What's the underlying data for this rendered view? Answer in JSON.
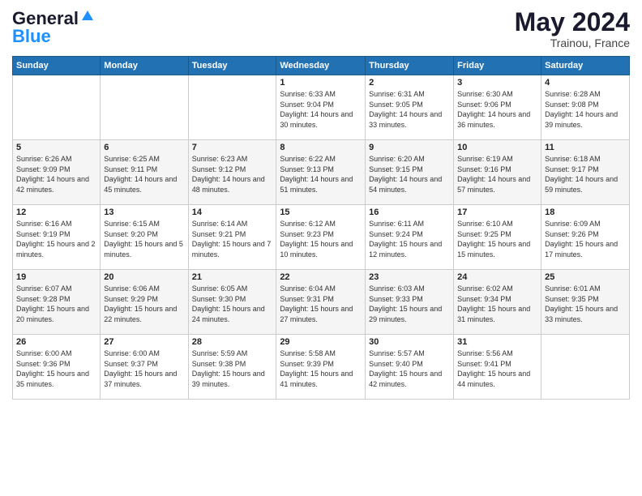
{
  "header": {
    "logo_general": "General",
    "logo_blue": "Blue",
    "month_year": "May 2024",
    "location": "Trainou, France"
  },
  "weekdays": [
    "Sunday",
    "Monday",
    "Tuesday",
    "Wednesday",
    "Thursday",
    "Friday",
    "Saturday"
  ],
  "weeks": [
    [
      {
        "day": "",
        "sunrise": "",
        "sunset": "",
        "daylight": ""
      },
      {
        "day": "",
        "sunrise": "",
        "sunset": "",
        "daylight": ""
      },
      {
        "day": "",
        "sunrise": "",
        "sunset": "",
        "daylight": ""
      },
      {
        "day": "1",
        "sunrise": "6:33 AM",
        "sunset": "9:04 PM",
        "daylight": "14 hours and 30 minutes."
      },
      {
        "day": "2",
        "sunrise": "6:31 AM",
        "sunset": "9:05 PM",
        "daylight": "14 hours and 33 minutes."
      },
      {
        "day": "3",
        "sunrise": "6:30 AM",
        "sunset": "9:06 PM",
        "daylight": "14 hours and 36 minutes."
      },
      {
        "day": "4",
        "sunrise": "6:28 AM",
        "sunset": "9:08 PM",
        "daylight": "14 hours and 39 minutes."
      }
    ],
    [
      {
        "day": "5",
        "sunrise": "6:26 AM",
        "sunset": "9:09 PM",
        "daylight": "14 hours and 42 minutes."
      },
      {
        "day": "6",
        "sunrise": "6:25 AM",
        "sunset": "9:11 PM",
        "daylight": "14 hours and 45 minutes."
      },
      {
        "day": "7",
        "sunrise": "6:23 AM",
        "sunset": "9:12 PM",
        "daylight": "14 hours and 48 minutes."
      },
      {
        "day": "8",
        "sunrise": "6:22 AM",
        "sunset": "9:13 PM",
        "daylight": "14 hours and 51 minutes."
      },
      {
        "day": "9",
        "sunrise": "6:20 AM",
        "sunset": "9:15 PM",
        "daylight": "14 hours and 54 minutes."
      },
      {
        "day": "10",
        "sunrise": "6:19 AM",
        "sunset": "9:16 PM",
        "daylight": "14 hours and 57 minutes."
      },
      {
        "day": "11",
        "sunrise": "6:18 AM",
        "sunset": "9:17 PM",
        "daylight": "14 hours and 59 minutes."
      }
    ],
    [
      {
        "day": "12",
        "sunrise": "6:16 AM",
        "sunset": "9:19 PM",
        "daylight": "15 hours and 2 minutes."
      },
      {
        "day": "13",
        "sunrise": "6:15 AM",
        "sunset": "9:20 PM",
        "daylight": "15 hours and 5 minutes."
      },
      {
        "day": "14",
        "sunrise": "6:14 AM",
        "sunset": "9:21 PM",
        "daylight": "15 hours and 7 minutes."
      },
      {
        "day": "15",
        "sunrise": "6:12 AM",
        "sunset": "9:23 PM",
        "daylight": "15 hours and 10 minutes."
      },
      {
        "day": "16",
        "sunrise": "6:11 AM",
        "sunset": "9:24 PM",
        "daylight": "15 hours and 12 minutes."
      },
      {
        "day": "17",
        "sunrise": "6:10 AM",
        "sunset": "9:25 PM",
        "daylight": "15 hours and 15 minutes."
      },
      {
        "day": "18",
        "sunrise": "6:09 AM",
        "sunset": "9:26 PM",
        "daylight": "15 hours and 17 minutes."
      }
    ],
    [
      {
        "day": "19",
        "sunrise": "6:07 AM",
        "sunset": "9:28 PM",
        "daylight": "15 hours and 20 minutes."
      },
      {
        "day": "20",
        "sunrise": "6:06 AM",
        "sunset": "9:29 PM",
        "daylight": "15 hours and 22 minutes."
      },
      {
        "day": "21",
        "sunrise": "6:05 AM",
        "sunset": "9:30 PM",
        "daylight": "15 hours and 24 minutes."
      },
      {
        "day": "22",
        "sunrise": "6:04 AM",
        "sunset": "9:31 PM",
        "daylight": "15 hours and 27 minutes."
      },
      {
        "day": "23",
        "sunrise": "6:03 AM",
        "sunset": "9:33 PM",
        "daylight": "15 hours and 29 minutes."
      },
      {
        "day": "24",
        "sunrise": "6:02 AM",
        "sunset": "9:34 PM",
        "daylight": "15 hours and 31 minutes."
      },
      {
        "day": "25",
        "sunrise": "6:01 AM",
        "sunset": "9:35 PM",
        "daylight": "15 hours and 33 minutes."
      }
    ],
    [
      {
        "day": "26",
        "sunrise": "6:00 AM",
        "sunset": "9:36 PM",
        "daylight": "15 hours and 35 minutes."
      },
      {
        "day": "27",
        "sunrise": "6:00 AM",
        "sunset": "9:37 PM",
        "daylight": "15 hours and 37 minutes."
      },
      {
        "day": "28",
        "sunrise": "5:59 AM",
        "sunset": "9:38 PM",
        "daylight": "15 hours and 39 minutes."
      },
      {
        "day": "29",
        "sunrise": "5:58 AM",
        "sunset": "9:39 PM",
        "daylight": "15 hours and 41 minutes."
      },
      {
        "day": "30",
        "sunrise": "5:57 AM",
        "sunset": "9:40 PM",
        "daylight": "15 hours and 42 minutes."
      },
      {
        "day": "31",
        "sunrise": "5:56 AM",
        "sunset": "9:41 PM",
        "daylight": "15 hours and 44 minutes."
      },
      {
        "day": "",
        "sunrise": "",
        "sunset": "",
        "daylight": ""
      }
    ]
  ]
}
